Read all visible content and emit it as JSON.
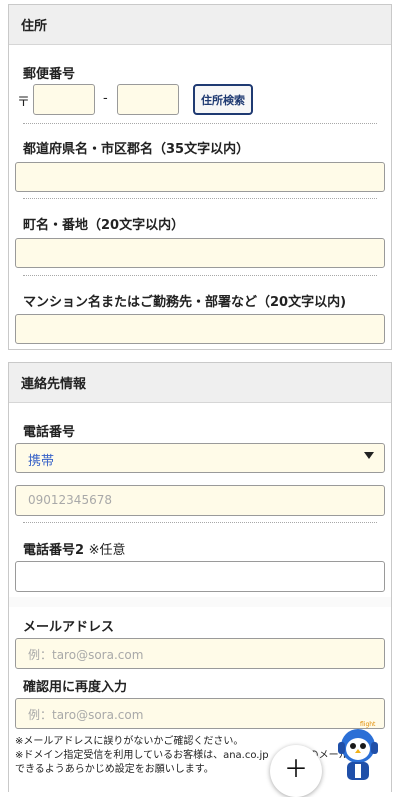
{
  "address_section": {
    "title": "住所",
    "postal_label": "郵便番号",
    "postal_mark": "〒",
    "postal_dash": "-",
    "address_search_button": "住所検索",
    "pref_label": "都道府県名・市区郡名（35文字以内）",
    "town_label": "町名・番地（20文字以内）",
    "building_label": "マンション名またはご勤務先・部署など（20文字以内)"
  },
  "contact_section": {
    "title": "連絡先情報",
    "phone_label": "電話番号",
    "phone_type_selected": "携帯",
    "phone_placeholder": "09012345678",
    "phone2_label": "電話番号2",
    "phone2_optional": "※任意",
    "email_label": "メールアドレス",
    "email_placeholder": "例：taro@sora.com",
    "confirm_label": "確認用に再度入力",
    "confirm_placeholder": "例：taro@sora.com",
    "notes": [
      "※メールアドレスに誤りがないかご確認ください。",
      "※ドメイン指定受信を利用しているお客様は、ana.co.jp",
      "できるようあらかじめ設定をお願いします。"
    ],
    "notes_tail": "のメール"
  },
  "fab": {
    "label": "＋"
  },
  "mascot": {
    "name": "mascot-icon",
    "tag": "flight"
  }
}
